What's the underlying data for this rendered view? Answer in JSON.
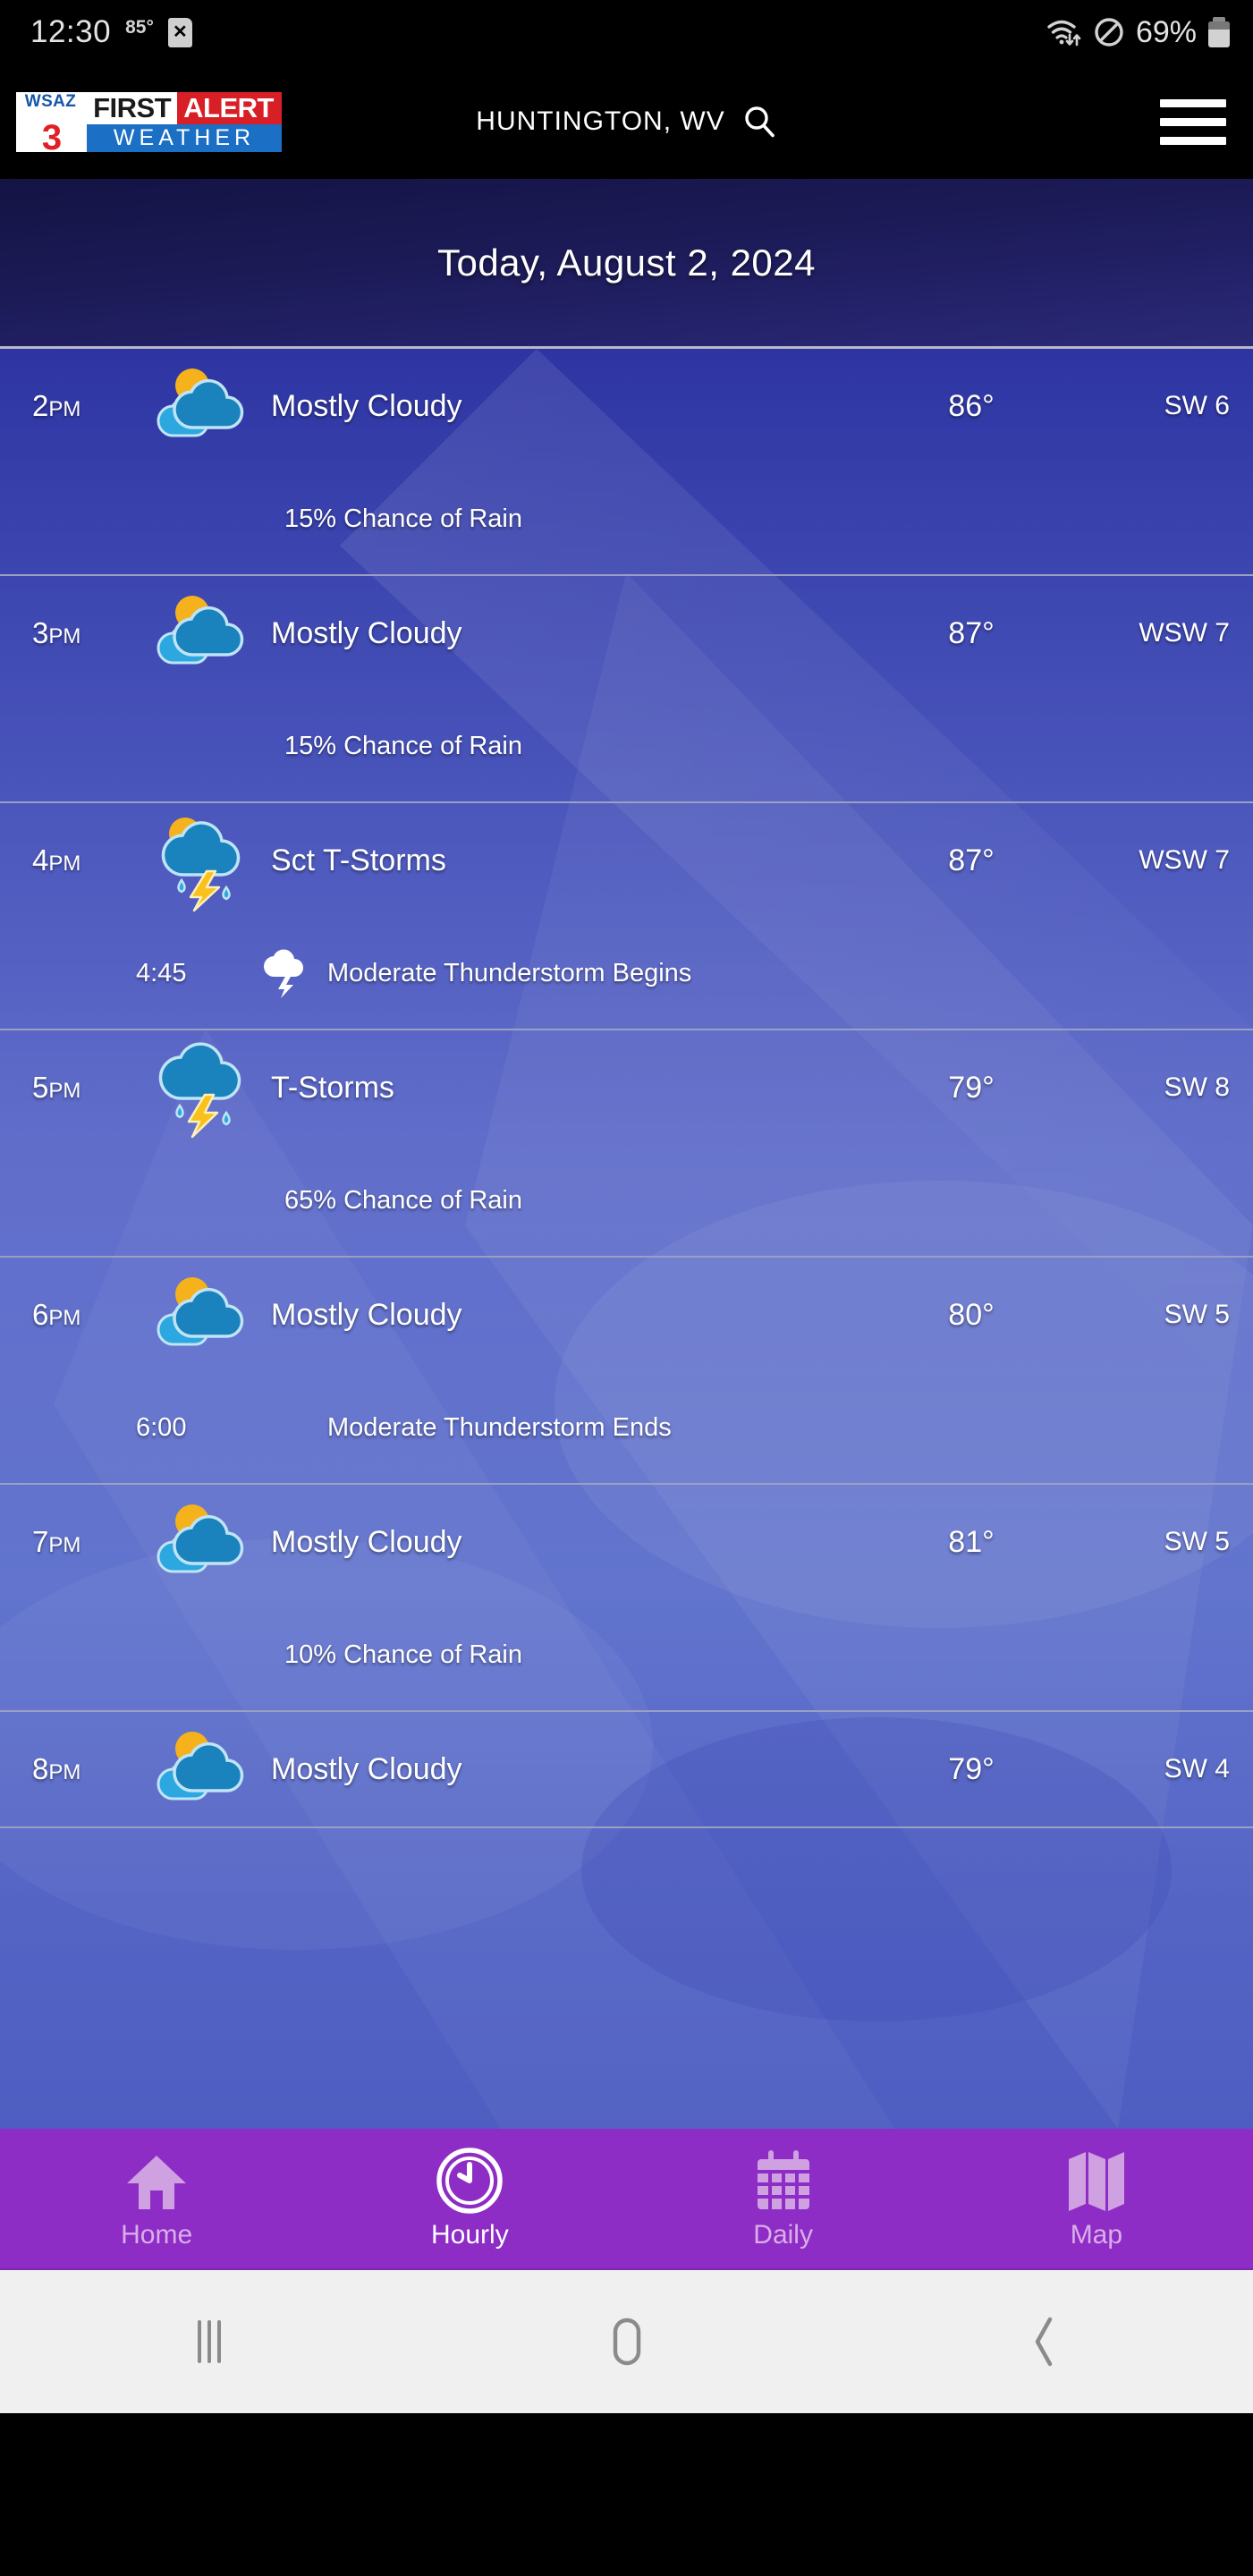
{
  "status_bar": {
    "clock": "12:30",
    "temperature": "85°",
    "sd_card_icon": "sd-card-error-icon",
    "wifi_icon": "wifi-data-transfer-icon",
    "dnd_icon": "do-not-disturb-icon",
    "battery_percent": "69%",
    "battery_icon": "battery-icon"
  },
  "app_bar": {
    "logo": {
      "station": "WSAZ",
      "channel": "3",
      "first": "FIRST",
      "alert": "ALERT",
      "weather": "WEATHER"
    },
    "location": "HUNTINGTON, WV",
    "search_icon": "search-icon",
    "menu_icon": "hamburger-menu-icon"
  },
  "date_header": {
    "title": "Today, August 2, 2024"
  },
  "hourly": [
    {
      "time": "2",
      "ampm": "PM",
      "icon": "partly-cloudy-icon",
      "condition": "Mostly Cloudy",
      "temp": "86°",
      "wind": "SW 6",
      "sub_type": "rain",
      "sub_text": "15% Chance of Rain"
    },
    {
      "time": "3",
      "ampm": "PM",
      "icon": "partly-cloudy-icon",
      "condition": "Mostly Cloudy",
      "temp": "87°",
      "wind": "WSW 7",
      "sub_type": "rain",
      "sub_text": "15% Chance of Rain"
    },
    {
      "time": "4",
      "ampm": "PM",
      "icon": "sct-thunderstorm-icon",
      "condition": "Sct T-Storms",
      "temp": "87°",
      "wind": "WSW 7",
      "sub_type": "alert",
      "sub_time": "4:45",
      "sub_icon": "thunderstorm-alert-icon",
      "sub_text": "Moderate Thunderstorm Begins"
    },
    {
      "time": "5",
      "ampm": "PM",
      "icon": "thunderstorm-icon",
      "condition": "T-Storms",
      "temp": "79°",
      "wind": "SW 8",
      "sub_type": "rain",
      "sub_text": "65% Chance of Rain"
    },
    {
      "time": "6",
      "ampm": "PM",
      "icon": "partly-cloudy-icon",
      "condition": "Mostly Cloudy",
      "temp": "80°",
      "wind": "SW 5",
      "sub_type": "alert",
      "sub_time": "6:00",
      "sub_icon": "",
      "sub_text": "Moderate Thunderstorm Ends"
    },
    {
      "time": "7",
      "ampm": "PM",
      "icon": "partly-cloudy-icon",
      "condition": "Mostly Cloudy",
      "temp": "81°",
      "wind": "SW 5",
      "sub_type": "rain",
      "sub_text": "10% Chance of Rain"
    },
    {
      "time": "8",
      "ampm": "PM",
      "icon": "partly-cloudy-icon",
      "condition": "Mostly Cloudy",
      "temp": "79°",
      "wind": "SW 4",
      "sub_type": "none",
      "sub_text": ""
    }
  ],
  "bottom_nav": {
    "items": [
      {
        "label": "Home",
        "icon": "home-icon",
        "active": false
      },
      {
        "label": "Hourly",
        "icon": "clock-icon",
        "active": true
      },
      {
        "label": "Daily",
        "icon": "calendar-icon",
        "active": false
      },
      {
        "label": "Map",
        "icon": "map-icon",
        "active": false
      }
    ]
  },
  "android_nav": {
    "recents_icon": "recents-icon",
    "home_icon": "home-circle-icon",
    "back_icon": "back-chevron-icon"
  },
  "colors": {
    "brand_red": "#d81f26",
    "brand_blue": "#1b6fc4",
    "nav_purple": "#8e2cc6",
    "sky_blue": "#4b5bc4",
    "header_navy": "#1b1a55",
    "sun_yellow": "#f5b21c",
    "cloud_blue": "#1a82bd",
    "bolt_yellow": "#f9c11c"
  }
}
